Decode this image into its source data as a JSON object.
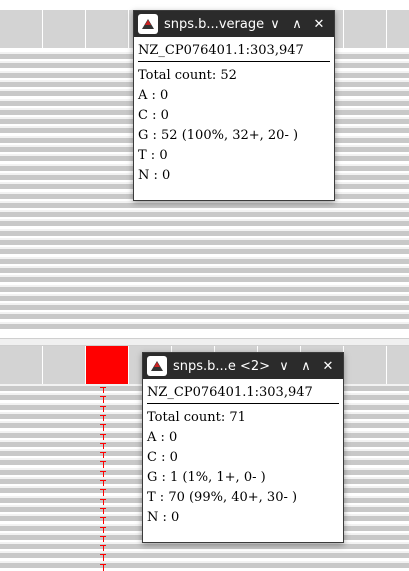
{
  "colors": {
    "coverage": "#d3d3d3",
    "snp": "#ff0000",
    "read": "#c8c8c8",
    "titlebar": "#2b2b2b"
  },
  "popup_top": {
    "title": "snps.b...verage",
    "icons": [
      "app-icon",
      "chevron-down-icon",
      "chevron-up-icon",
      "close-icon"
    ],
    "window_buttons": {
      "minimize": "∨",
      "maximize": "∧",
      "close": "✕"
    },
    "locus": "NZ_CP076401.1:303,947",
    "total": "Total count: 52",
    "a": "A : 0",
    "c": "C : 0",
    "g": "G : 52 (100%, 32+, 20- )",
    "t": "T : 0",
    "n": "N : 0"
  },
  "popup_bottom": {
    "title": "snps.b...e <2>",
    "icons": [
      "app-icon",
      "chevron-down-icon",
      "chevron-up-icon",
      "close-icon"
    ],
    "window_buttons": {
      "minimize": "∨",
      "maximize": "∧",
      "close": "✕"
    },
    "locus": "NZ_CP076401.1:303,947",
    "total": "Total count: 71",
    "a": "A : 0",
    "c": "C : 0",
    "g": "G : 1 (1%, 1+, 0- )",
    "t": "T : 70 (99%, 40+, 30- )",
    "n": "N : 0"
  }
}
